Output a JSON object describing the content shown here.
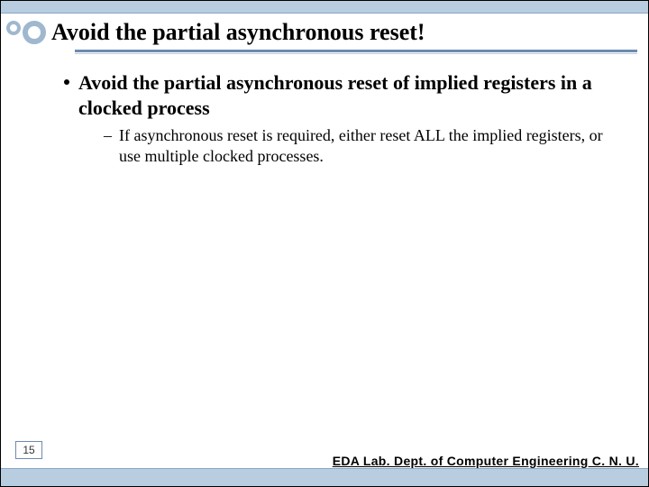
{
  "title": "Avoid the partial asynchronous reset!",
  "bullets": [
    {
      "text": "Avoid the partial asynchronous reset of implied registers in a clocked process",
      "sub": [
        "If asynchronous reset is required, either reset ALL the implied registers, or use multiple clocked processes."
      ]
    }
  ],
  "page_number": "15",
  "footer": "EDA Lab. Dept. of Computer Engineering C. N. U."
}
